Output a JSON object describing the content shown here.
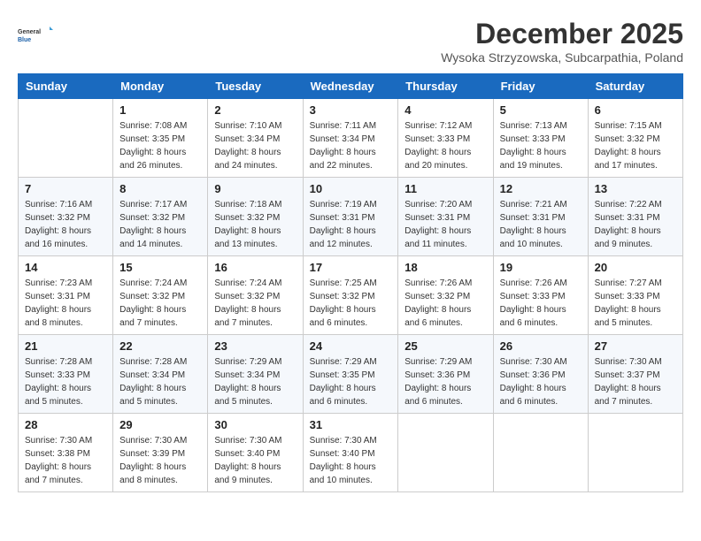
{
  "header": {
    "logo_line1": "General",
    "logo_line2": "Blue",
    "month": "December 2025",
    "location": "Wysoka Strzyzowska, Subcarpathia, Poland"
  },
  "days_of_week": [
    "Sunday",
    "Monday",
    "Tuesday",
    "Wednesday",
    "Thursday",
    "Friday",
    "Saturday"
  ],
  "weeks": [
    [
      {
        "day": "",
        "info": ""
      },
      {
        "day": "1",
        "info": "Sunrise: 7:08 AM\nSunset: 3:35 PM\nDaylight: 8 hours\nand 26 minutes."
      },
      {
        "day": "2",
        "info": "Sunrise: 7:10 AM\nSunset: 3:34 PM\nDaylight: 8 hours\nand 24 minutes."
      },
      {
        "day": "3",
        "info": "Sunrise: 7:11 AM\nSunset: 3:34 PM\nDaylight: 8 hours\nand 22 minutes."
      },
      {
        "day": "4",
        "info": "Sunrise: 7:12 AM\nSunset: 3:33 PM\nDaylight: 8 hours\nand 20 minutes."
      },
      {
        "day": "5",
        "info": "Sunrise: 7:13 AM\nSunset: 3:33 PM\nDaylight: 8 hours\nand 19 minutes."
      },
      {
        "day": "6",
        "info": "Sunrise: 7:15 AM\nSunset: 3:32 PM\nDaylight: 8 hours\nand 17 minutes."
      }
    ],
    [
      {
        "day": "7",
        "info": "Sunrise: 7:16 AM\nSunset: 3:32 PM\nDaylight: 8 hours\nand 16 minutes."
      },
      {
        "day": "8",
        "info": "Sunrise: 7:17 AM\nSunset: 3:32 PM\nDaylight: 8 hours\nand 14 minutes."
      },
      {
        "day": "9",
        "info": "Sunrise: 7:18 AM\nSunset: 3:32 PM\nDaylight: 8 hours\nand 13 minutes."
      },
      {
        "day": "10",
        "info": "Sunrise: 7:19 AM\nSunset: 3:31 PM\nDaylight: 8 hours\nand 12 minutes."
      },
      {
        "day": "11",
        "info": "Sunrise: 7:20 AM\nSunset: 3:31 PM\nDaylight: 8 hours\nand 11 minutes."
      },
      {
        "day": "12",
        "info": "Sunrise: 7:21 AM\nSunset: 3:31 PM\nDaylight: 8 hours\nand 10 minutes."
      },
      {
        "day": "13",
        "info": "Sunrise: 7:22 AM\nSunset: 3:31 PM\nDaylight: 8 hours\nand 9 minutes."
      }
    ],
    [
      {
        "day": "14",
        "info": "Sunrise: 7:23 AM\nSunset: 3:31 PM\nDaylight: 8 hours\nand 8 minutes."
      },
      {
        "day": "15",
        "info": "Sunrise: 7:24 AM\nSunset: 3:32 PM\nDaylight: 8 hours\nand 7 minutes."
      },
      {
        "day": "16",
        "info": "Sunrise: 7:24 AM\nSunset: 3:32 PM\nDaylight: 8 hours\nand 7 minutes."
      },
      {
        "day": "17",
        "info": "Sunrise: 7:25 AM\nSunset: 3:32 PM\nDaylight: 8 hours\nand 6 minutes."
      },
      {
        "day": "18",
        "info": "Sunrise: 7:26 AM\nSunset: 3:32 PM\nDaylight: 8 hours\nand 6 minutes."
      },
      {
        "day": "19",
        "info": "Sunrise: 7:26 AM\nSunset: 3:33 PM\nDaylight: 8 hours\nand 6 minutes."
      },
      {
        "day": "20",
        "info": "Sunrise: 7:27 AM\nSunset: 3:33 PM\nDaylight: 8 hours\nand 5 minutes."
      }
    ],
    [
      {
        "day": "21",
        "info": "Sunrise: 7:28 AM\nSunset: 3:33 PM\nDaylight: 8 hours\nand 5 minutes."
      },
      {
        "day": "22",
        "info": "Sunrise: 7:28 AM\nSunset: 3:34 PM\nDaylight: 8 hours\nand 5 minutes."
      },
      {
        "day": "23",
        "info": "Sunrise: 7:29 AM\nSunset: 3:34 PM\nDaylight: 8 hours\nand 5 minutes."
      },
      {
        "day": "24",
        "info": "Sunrise: 7:29 AM\nSunset: 3:35 PM\nDaylight: 8 hours\nand 6 minutes."
      },
      {
        "day": "25",
        "info": "Sunrise: 7:29 AM\nSunset: 3:36 PM\nDaylight: 8 hours\nand 6 minutes."
      },
      {
        "day": "26",
        "info": "Sunrise: 7:30 AM\nSunset: 3:36 PM\nDaylight: 8 hours\nand 6 minutes."
      },
      {
        "day": "27",
        "info": "Sunrise: 7:30 AM\nSunset: 3:37 PM\nDaylight: 8 hours\nand 7 minutes."
      }
    ],
    [
      {
        "day": "28",
        "info": "Sunrise: 7:30 AM\nSunset: 3:38 PM\nDaylight: 8 hours\nand 7 minutes."
      },
      {
        "day": "29",
        "info": "Sunrise: 7:30 AM\nSunset: 3:39 PM\nDaylight: 8 hours\nand 8 minutes."
      },
      {
        "day": "30",
        "info": "Sunrise: 7:30 AM\nSunset: 3:40 PM\nDaylight: 8 hours\nand 9 minutes."
      },
      {
        "day": "31",
        "info": "Sunrise: 7:30 AM\nSunset: 3:40 PM\nDaylight: 8 hours\nand 10 minutes."
      },
      {
        "day": "",
        "info": ""
      },
      {
        "day": "",
        "info": ""
      },
      {
        "day": "",
        "info": ""
      }
    ]
  ]
}
